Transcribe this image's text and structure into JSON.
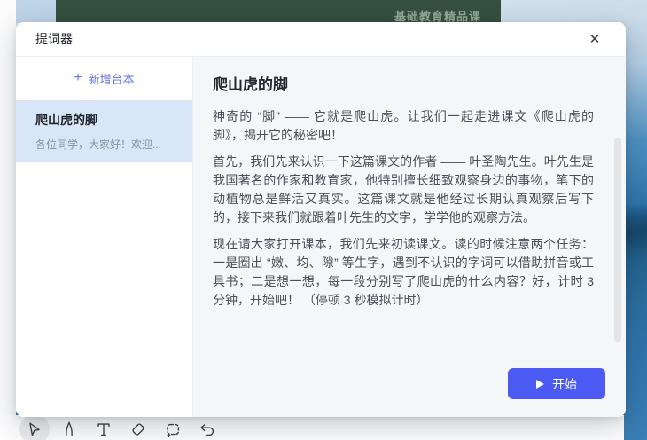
{
  "background": {
    "slide_banner_text": "基础教育精品课"
  },
  "modal": {
    "title": "提词器"
  },
  "icons": {
    "close": "✕",
    "plus": "+"
  },
  "sidebar": {
    "add_button_label": "新增台本",
    "items": [
      {
        "title": "爬山虎的脚",
        "preview": "各位同学，大家好！欢迎...",
        "selected": true
      }
    ]
  },
  "content": {
    "title": "爬山虎的脚",
    "paragraphs": [
      "神奇的 “脚” —— 它就是爬山虎。让我们一起走进课文《爬山虎的脚》，揭开它的秘密吧！",
      "首先，我们先来认识一下这篇课文的作者 —— 叶圣陶先生。叶先生是我国著名的作家和教育家，他特别擅长细致观察身边的事物，笔下的动植物总是鲜活又真实。这篇课文就是他经过长期认真观察后写下的，接下来我们就跟着叶先生的文字，学学他的观察方法。",
      "现在请大家打开课本，我们先来初读课文。读的时候注意两个任务：一是圈出 “嫩、均、隙” 等生字，遇到不认识的字词可以借助拼音或工具书；二是想一想，每一段分别写了爬山虎的什么内容？好，计时 3 分钟，开始吧！ （停顿 3 秒模拟计时）"
    ],
    "start_button_label": "开始"
  },
  "toolbar": {
    "tools": [
      "cursor-tool",
      "pen-tool",
      "text-tool",
      "eraser-tool",
      "lasso-tool",
      "undo-tool"
    ],
    "active_tool": "cursor-tool"
  },
  "colors": {
    "accent_blue": "#4a5af2",
    "add_link_blue": "#6272e4",
    "selected_item_bg": "#d8e6f7",
    "main_bg": "#f5f6f8",
    "slide_green": "#35503e"
  }
}
